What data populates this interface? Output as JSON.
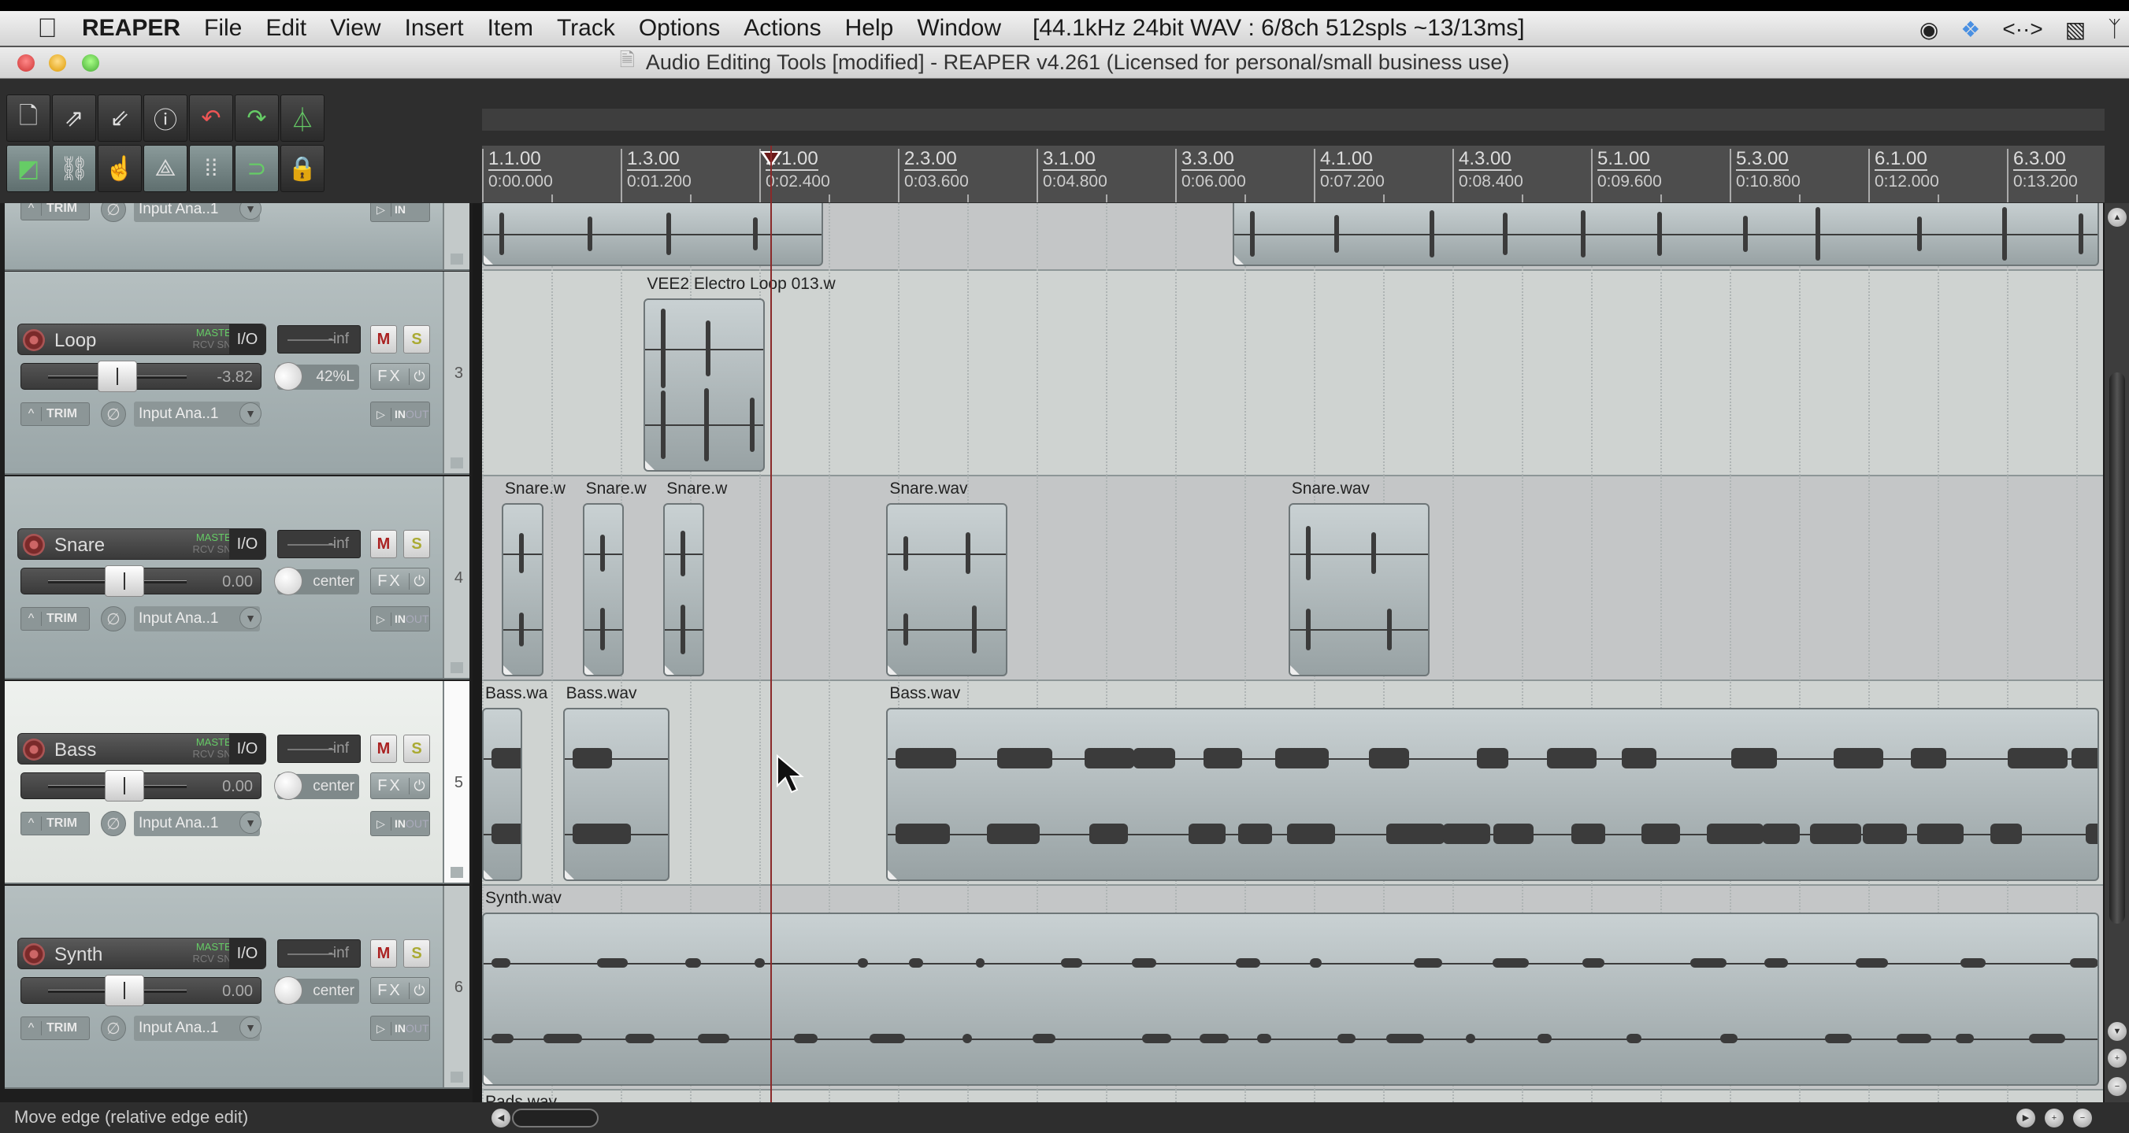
{
  "menubar": {
    "app": "REAPER",
    "items": [
      "File",
      "Edit",
      "View",
      "Insert",
      "Item",
      "Track",
      "Options",
      "Actions",
      "Help",
      "Window"
    ],
    "status": "[44.1kHz 24bit WAV : 6/8ch 512spls ~13/13ms]",
    "tray": [
      "camera-icon",
      "dropbox-icon",
      "code-brackets-icon",
      "displays-icon",
      "bluetooth-icon"
    ]
  },
  "window": {
    "title": "Audio Editing Tools [modified] - REAPER v4.261 (Licensed for personal/small business use)"
  },
  "toolbar": {
    "row1": [
      {
        "name": "new-project",
        "glyph": "🗋"
      },
      {
        "name": "open-project",
        "glyph": "⇗"
      },
      {
        "name": "save-project",
        "glyph": "⇙"
      },
      {
        "name": "project-info",
        "glyph": "ⓘ"
      },
      {
        "name": "undo",
        "glyph": "↶"
      },
      {
        "name": "redo",
        "glyph": "↷"
      },
      {
        "name": "metronome",
        "glyph": "⏃"
      }
    ],
    "row2": [
      {
        "name": "auto-crossfade",
        "glyph": "◩",
        "on": true
      },
      {
        "name": "ripple-edit",
        "glyph": "⛓",
        "on": true
      },
      {
        "name": "item-grouping",
        "glyph": "☝",
        "on": false
      },
      {
        "name": "envelope-points",
        "glyph": "⟁",
        "on": true
      },
      {
        "name": "grid",
        "glyph": "⁞⁞",
        "on": true
      },
      {
        "name": "snap",
        "glyph": "⊃",
        "on": true
      },
      {
        "name": "locking",
        "glyph": "🔒",
        "on": false
      }
    ]
  },
  "ruler": {
    "marks": [
      {
        "bar": "1.1.00",
        "time": "0:00.000"
      },
      {
        "bar": "1.3.00",
        "time": "0:01.200"
      },
      {
        "bar": "2.1.00",
        "time": "0:02.400"
      },
      {
        "bar": "2.3.00",
        "time": "0:03.600"
      },
      {
        "bar": "3.1.00",
        "time": "0:04.800"
      },
      {
        "bar": "3.3.00",
        "time": "0:06.000"
      },
      {
        "bar": "4.1.00",
        "time": "0:07.200"
      },
      {
        "bar": "4.3.00",
        "time": "0:08.400"
      },
      {
        "bar": "5.1.00",
        "time": "0:09.600"
      },
      {
        "bar": "5.3.00",
        "time": "0:10.800"
      },
      {
        "bar": "6.1.00",
        "time": "0:12.000"
      },
      {
        "bar": "6.3.00",
        "time": "0:13.200"
      }
    ],
    "edit_cursor_time_s": 2.5
  },
  "tracks": [
    {
      "num": "3",
      "name": "Loop",
      "route_master": "MASTER",
      "route_rcv": "RCV SND",
      "io": "I/O",
      "meter": "-inf",
      "volume": "-3.82",
      "fader_pos": 0.5,
      "pan": "42%L",
      "mute": "M",
      "solo": "S",
      "fx": "FX",
      "trim": "TRIM",
      "input": "Input Ana..1",
      "in": "IN",
      "out": "OUT",
      "selected": false
    },
    {
      "num": "4",
      "name": "Snare",
      "route_master": "MASTER",
      "route_rcv": "RCV SND",
      "io": "I/O",
      "meter": "-inf",
      "volume": "0.00",
      "fader_pos": 0.55,
      "pan": "center",
      "mute": "M",
      "solo": "S",
      "fx": "FX",
      "trim": "TRIM",
      "input": "Input Ana..1",
      "in": "IN",
      "out": "OUT",
      "selected": false
    },
    {
      "num": "5",
      "name": "Bass",
      "route_master": "MASTER",
      "route_rcv": "RCV SND",
      "io": "I/O",
      "meter": "-inf",
      "volume": "0.00",
      "fader_pos": 0.55,
      "pan": "center",
      "mute": "M",
      "solo": "S",
      "fx": "FX",
      "trim": "TRIM",
      "input": "Input Ana..1",
      "in": "IN",
      "out": "OUT",
      "selected": true
    },
    {
      "num": "6",
      "name": "Synth",
      "route_master": "MASTER",
      "route_rcv": "RCV SND",
      "io": "I/O",
      "meter": "-inf",
      "volume": "0.00",
      "fader_pos": 0.55,
      "pan": "center",
      "mute": "M",
      "solo": "S",
      "fx": "FX",
      "trim": "TRIM",
      "input": "Input Ana..1",
      "in": "IN",
      "out": "OUT",
      "selected": false
    }
  ],
  "partial_track_top": {
    "trim": "TRIM",
    "input": "Input Ana..1",
    "in": "IN"
  },
  "items": {
    "top": [
      {
        "label": "",
        "start_s": 0.0,
        "end_s": 2.95
      },
      {
        "label": "",
        "start_s": 6.5,
        "end_s": 14.0
      }
    ],
    "loop": [
      {
        "label": "VEE2 Electro Loop 013.w",
        "start_s": 1.4,
        "end_s": 2.45
      }
    ],
    "snare": [
      {
        "label": "Snare.w",
        "start_s": 0.17,
        "end_s": 0.53
      },
      {
        "label": "Snare.w",
        "start_s": 0.87,
        "end_s": 1.23
      },
      {
        "label": "Snare.w",
        "start_s": 1.57,
        "end_s": 1.92
      },
      {
        "label": "Snare.wav",
        "start_s": 3.5,
        "end_s": 4.55
      },
      {
        "label": "Snare.wav",
        "start_s": 6.98,
        "end_s": 8.2
      }
    ],
    "bass": [
      {
        "label": "Bass.wa",
        "start_s": 0.0,
        "end_s": 0.35
      },
      {
        "label": "Bass.wav",
        "start_s": 0.7,
        "end_s": 1.62
      },
      {
        "label": "Bass.wav",
        "start_s": 3.5,
        "end_s": 14.0
      }
    ],
    "synth": [
      {
        "label": "Synth.wav",
        "start_s": 0.0,
        "end_s": 14.0
      }
    ],
    "pads_label": "Pads.wav"
  },
  "status_bar": {
    "text": "Move edge (relative edge edit)"
  }
}
